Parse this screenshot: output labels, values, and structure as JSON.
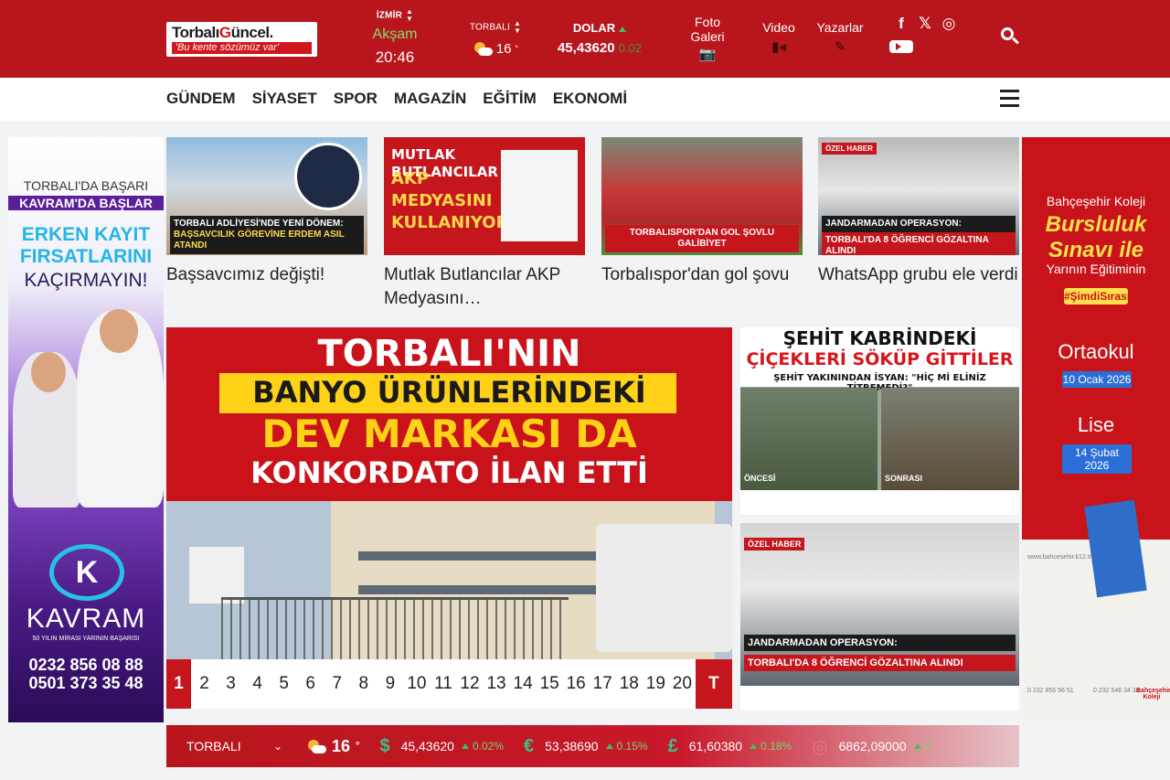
{
  "header": {
    "logo_main_a": "Torbalı",
    "logo_main_g": "G",
    "logo_main_b": "üncel.",
    "logo_slogan": "'Bu kente sözümüz var'",
    "prayer": {
      "city": "İZMİR",
      "name": "Akşam",
      "time": "20:46"
    },
    "weather": {
      "city": "TORBALI",
      "temp": "16",
      "deg": "°"
    },
    "dolar": {
      "label": "DOLAR",
      "value": "45,43620",
      "change": "0.02"
    },
    "foto_galeri": "Foto\nGaleri",
    "video": "Video",
    "yazarlar": "Yazarlar"
  },
  "nav": {
    "items": [
      "GÜNDEM",
      "SİYASET",
      "SPOR",
      "MAGAZİN",
      "EĞİTİM",
      "EKONOMİ"
    ]
  },
  "ad_left": {
    "line1": "TORBALI'DA BAŞARI",
    "line2": "KAVRAM'DA BAŞLAR",
    "line3": "ERKEN KAYIT\nFIRSATLARINI",
    "line4": "KAÇIRMAYIN!",
    "brand_letter": "K",
    "brand": "KAVRAM",
    "brand_sub": "50 YILIN MİRASI YARININ BAŞARISI",
    "phone1": "0232 856 08 88",
    "phone2": "0501 373 35 48"
  },
  "ad_right": {
    "line1": "Bahçeşehir Koleji",
    "line2": "Bursluluk Sınavı ile",
    "line3": "Yarının Eğitiminin",
    "tag": "#ŞimdiSırası",
    "level1": "Ortaokul",
    "date1": "10 Ocak 2026",
    "level2": "Lise",
    "date2": "14 Şubat 2026",
    "web": "www.bahcesehir.k12.tr",
    "phone_a": "0 232 855 56 51",
    "phone_b": "0 232 546 34 34",
    "brand": "Bahçeşehir Koleji"
  },
  "cards": [
    {
      "band": "TORBALI ADLİYESİ'NDE YENİ DÖNEM:",
      "band2": "BAŞSAVCILIK GÖREVİNE ERDEM ASIL ATANDI",
      "title": "Başsavcımız değişti!"
    },
    {
      "band": "MUTLAK BUTLANCILAR",
      "band2": "AKP MEDYASINI KULLANIYOR!",
      "title": "Mutlak Butlancılar AKP Medyasını…"
    },
    {
      "band": "TORBALISPOR'DAN GOL ŞOVLU GALİBİYET",
      "band2": "",
      "title": "Torbalıspor'dan gol şovu"
    },
    {
      "badge": "ÖZEL HABER",
      "band": "JANDARMADAN OPERASYON:",
      "band2": "TORBALI'DA 8 ÖĞRENCİ GÖZALTINA ALINDI",
      "title": "WhatsApp grubu ele verdi"
    }
  ],
  "slider": {
    "line1": "TORBALI'NIN",
    "line2": "BANYO ÜRÜNLERİNDEKİ",
    "line3": "DEV MARKASI DA",
    "line4": "KONKORDATO İLAN ETTİ",
    "pages": [
      "1",
      "2",
      "3",
      "4",
      "5",
      "6",
      "7",
      "8",
      "9",
      "10",
      "11",
      "12",
      "13",
      "14",
      "15",
      "16",
      "17",
      "18",
      "19",
      "20"
    ],
    "last_btn": "T",
    "active_page": 1
  },
  "side1": {
    "line1": "ŞEHİT KABRİNDEKİ",
    "line2": "ÇİÇEKLERİ SÖKÜP GİTTİLER",
    "line3": "ŞEHİT YAKININDAN İSYAN: \"HİÇ Mİ ELİNİZ TİTREMEDİ?\"",
    "before": "ÖNCESİ",
    "after": "SONRASI"
  },
  "side2": {
    "badge": "ÖZEL HABER",
    "band": "JANDARMADAN OPERASYON:",
    "band2": "TORBALI'DA 8 ÖĞRENCİ GÖZALTINA ALINDI"
  },
  "ticker": {
    "city": "TORBALI",
    "temp": "16",
    "deg": "°",
    "items": [
      {
        "sym": "$",
        "value": "45,43620",
        "pct": "0.02%"
      },
      {
        "sym": "€",
        "value": "53,38690",
        "pct": "0.15%"
      },
      {
        "sym": "£",
        "value": "61,60380",
        "pct": "0.18%"
      },
      {
        "sym": "◎",
        "value": "6862,09000",
        "pct": "0"
      }
    ]
  },
  "colors": {
    "brand_red": "#b8161c",
    "accent_green": "#7ee06e"
  }
}
